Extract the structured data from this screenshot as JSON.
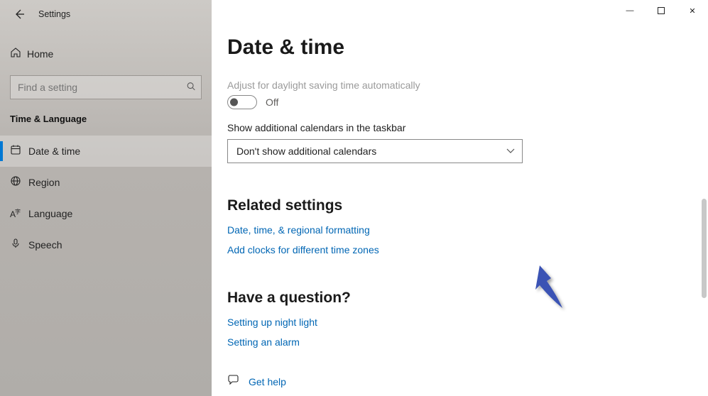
{
  "app_title": "Settings",
  "home_label": "Home",
  "search_placeholder": "Find a setting",
  "category": "Time & Language",
  "nav": [
    {
      "label": "Date & time",
      "icon": "🕑",
      "selected": true
    },
    {
      "label": "Region",
      "icon": "🌐",
      "selected": false
    },
    {
      "label": "Language",
      "icon": "A字",
      "selected": false
    },
    {
      "label": "Speech",
      "icon": "🎤",
      "selected": false
    }
  ],
  "page": {
    "title": "Date & time",
    "dst": {
      "label": "Adjust for daylight saving time automatically",
      "state": "Off"
    },
    "additional_cal": {
      "label": "Show additional calendars in the taskbar",
      "value": "Don't show additional calendars"
    },
    "related_heading": "Related settings",
    "related_links": [
      "Date, time, & regional formatting",
      "Add clocks for different time zones"
    ],
    "question_heading": "Have a question?",
    "question_links": [
      "Setting up night light",
      "Setting an alarm"
    ],
    "get_help": "Get help"
  },
  "chrome": {
    "min": "—",
    "max": "▢",
    "close": "✕"
  }
}
